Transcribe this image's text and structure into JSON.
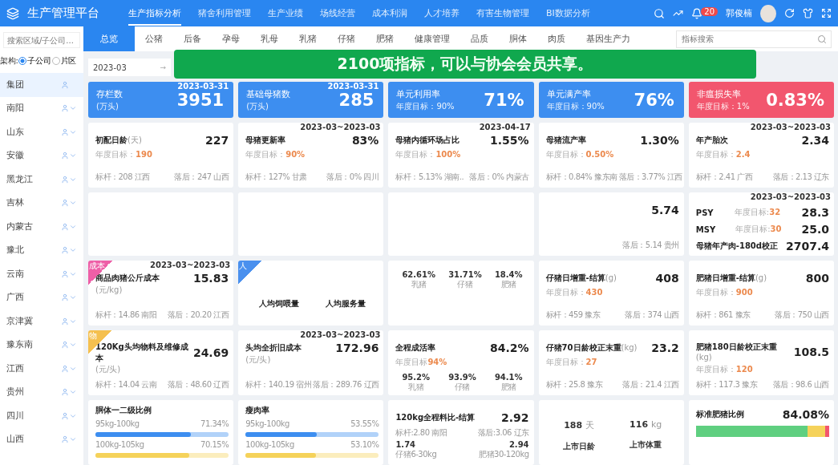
{
  "app": {
    "title": "生产管理平台"
  },
  "nav": [
    {
      "label": "生产指标分析",
      "selected": true
    },
    {
      "label": "猪舍利用管理",
      "selected": false
    },
    {
      "label": "生产业绩",
      "selected": false
    },
    {
      "label": "场线经营",
      "selected": false
    },
    {
      "label": "成本利润",
      "selected": false
    },
    {
      "label": "人才培养",
      "selected": false
    },
    {
      "label": "有害生物管理",
      "selected": false
    },
    {
      "label": "BI数据分析",
      "selected": false
    }
  ],
  "user": {
    "name": "郭俊楠",
    "notifications": "20"
  },
  "sidebar": {
    "search_placeholder": "搜索区域/子公司...",
    "structure_label": "架构:",
    "structure_options": [
      {
        "label": "子公司",
        "selected": true
      },
      {
        "label": "片区",
        "selected": false
      }
    ],
    "items": [
      {
        "label": "集团",
        "selected": true,
        "expandable": false
      },
      {
        "label": "南阳",
        "selected": false,
        "expandable": true
      },
      {
        "label": "山东",
        "selected": false,
        "expandable": true
      },
      {
        "label": "安徽",
        "selected": false,
        "expandable": true
      },
      {
        "label": "黑龙江",
        "selected": false,
        "expandable": true
      },
      {
        "label": "吉林",
        "selected": false,
        "expandable": true
      },
      {
        "label": "内蒙古",
        "selected": false,
        "expandable": true
      },
      {
        "label": "豫北",
        "selected": false,
        "expandable": true
      },
      {
        "label": "云南",
        "selected": false,
        "expandable": true
      },
      {
        "label": "广西",
        "selected": false,
        "expandable": true
      },
      {
        "label": "京津冀",
        "selected": false,
        "expandable": true
      },
      {
        "label": "豫东南",
        "selected": false,
        "expandable": true
      },
      {
        "label": "江西",
        "selected": false,
        "expandable": true
      },
      {
        "label": "贵州",
        "selected": false,
        "expandable": true
      },
      {
        "label": "四川",
        "selected": false,
        "expandable": true
      },
      {
        "label": "山西",
        "selected": false,
        "expandable": true
      }
    ]
  },
  "tabs": [
    {
      "label": "总览",
      "selected": true
    },
    {
      "label": "公猪",
      "selected": false
    },
    {
      "label": "后备",
      "selected": false
    },
    {
      "label": "孕母",
      "selected": false
    },
    {
      "label": "乳母",
      "selected": false
    },
    {
      "label": "乳猪",
      "selected": false
    },
    {
      "label": "仔猪",
      "selected": false
    },
    {
      "label": "肥猪",
      "selected": false
    },
    {
      "label": "健康管理",
      "selected": false
    },
    {
      "label": "品质",
      "selected": false
    },
    {
      "label": "胴体",
      "selected": false
    },
    {
      "label": "肉质",
      "selected": false
    },
    {
      "label": "基因生产力",
      "selected": false
    }
  ],
  "indicator_search": {
    "placeholder": "指标搜索"
  },
  "date_field": {
    "value": "2023-03",
    "arrow": "→"
  },
  "banner": {
    "text": "2100项指标，可以与协会会员共享。"
  },
  "kpis": [
    {
      "title": "存栏数",
      "sub": "(万头)",
      "value": "3951",
      "date": "2023-03-31",
      "color": "#3d8ef0"
    },
    {
      "title": "基础母猪数",
      "sub": "(万头)",
      "value": "285",
      "date": "2023-03-31",
      "color": "#3d8ef0"
    },
    {
      "title": "单元利用率",
      "sub": "年度目标：90%",
      "value": "71%",
      "color": "#3d8ef0"
    },
    {
      "title": "单元满产率",
      "sub": "年度目标：90%",
      "value": "76%",
      "color": "#3d8ef0"
    },
    {
      "title": "非瘟损失率",
      "sub": "年度目标：1%",
      "value": "0.83%",
      "color": "#f2566e"
    }
  ],
  "cards": [
    {
      "kind": "metric",
      "title": "初配日龄",
      "unit": "(天)",
      "value": "227",
      "target_label": "年度目标：",
      "target": "190",
      "bench": "标杆：208 江西",
      "lag": "落后：247 山西"
    },
    {
      "kind": "metric",
      "date": "2023-03~2023-03",
      "title": "母猪更新率",
      "value": "83%",
      "target_label": "年度目标：",
      "target": "90%",
      "bench": "标杆：127% 甘肃",
      "lag": "落后：0% 四川"
    },
    {
      "kind": "metric",
      "date": "2023-04-17",
      "title": "母猪内循环场占比",
      "value": "1.55%",
      "target_label": "年度目标：",
      "target": "100%",
      "bench": "标杆：5.13% 湖南..",
      "lag": "落后：0% 内蒙古"
    },
    {
      "kind": "metric",
      "title": "母猪流产率",
      "value": "1.30%",
      "target_label": "年度目标：",
      "target": "0.50%",
      "bench": "标杆：0.84% 豫东南",
      "lag": "落后：3.77% 江西"
    },
    {
      "kind": "metric",
      "date": "2023-03~2023-03",
      "title": "年产胎次",
      "value": "2.34",
      "target_label": "年度目标：",
      "target": "2.4",
      "bench": "标杆：2.41 广西",
      "lag": "落后：2.13 辽东"
    },
    {
      "kind": "metric"
    },
    {
      "kind": "metric"
    },
    {
      "kind": "metric"
    },
    {
      "kind": "metric",
      "value": "5.74",
      "lag": "落后：5.14 贵州"
    },
    {
      "kind": "rows",
      "date": "2023-03~2023-03",
      "rows": [
        {
          "name": "PSY",
          "target_label": "年度目标:",
          "target": "32",
          "value": "28.3"
        },
        {
          "name": "MSY",
          "target_label": "年度目标:",
          "target": "30",
          "value": "25.0"
        },
        {
          "name": "母猪年产肉-180d校正",
          "value": "2707.4"
        }
      ]
    },
    {
      "kind": "metric",
      "badge": {
        "label": "成本",
        "color": "#ee5fa7"
      },
      "date": "2023-03~2023-03",
      "title": "商品肉猪公斤成本",
      "value": "15.83",
      "sub": "(元/kg)",
      "bench": "标杆：14.86 南阳",
      "lag": "落后：20.20 江西"
    },
    {
      "kind": "people",
      "badge": {
        "label": "人",
        "color": "#4a90ee"
      },
      "labels": [
        "人均饲喂量",
        "人均服务量"
      ]
    },
    {
      "kind": "metric",
      "stats": [
        {
          "value": "62.61%",
          "label": "乳猪"
        },
        {
          "value": "31.71%",
          "label": "仔猪"
        },
        {
          "value": "18.4%",
          "label": "肥猪"
        }
      ]
    },
    {
      "kind": "metric",
      "title": "仔猪日增重-结算",
      "unit": "(g)",
      "value": "408",
      "target_label": "年度目标：",
      "target": "430",
      "bench": "标杆：459 豫东",
      "lag": "落后：374 山西"
    },
    {
      "kind": "metric",
      "title": "肥猪日增重-结算",
      "unit": "(g)",
      "value": "800",
      "target_label": "年度目标：",
      "target": "900",
      "bench": "标杆：861 豫东",
      "lag": "落后：750 山西"
    },
    {
      "kind": "metric",
      "badge": {
        "label": "物",
        "color": "#f5c04f"
      },
      "title": "120Kg头均物料及维修成本",
      "value": "24.69",
      "sub": "(元/头)",
      "bench": "标杆：14.04 云南",
      "lag": "落后：48.60 辽西"
    },
    {
      "kind": "metric",
      "date": "2023-03~2023-03",
      "title": "头均全折旧成本",
      "value": "172.96",
      "sub": "(元/头)",
      "bench": "标杆：140.19 宿州",
      "lag": "落后：289.76 辽西"
    },
    {
      "kind": "metric",
      "title": "全程成活率",
      "value": "84.2%",
      "target_label": "年度目标",
      "target": "94%",
      "stats": [
        {
          "value": "95.2%",
          "label": "乳猪"
        },
        {
          "value": "93.9%",
          "label": "仔猪"
        },
        {
          "value": "94.1%",
          "label": "肥猪"
        }
      ]
    },
    {
      "kind": "metric",
      "title": "仔猪70日龄校正末重",
      "unit": "(kg)",
      "value": "23.2",
      "target_label": "年度目标：",
      "target": "27",
      "bench": "标杆：25.8 豫东",
      "lag": "落后：21.4 江西"
    },
    {
      "kind": "metric",
      "title": "肥猪180日龄校正末重",
      "unit": "(kg)",
      "value": "108.5",
      "target_label": "年度目标：",
      "target": "120",
      "bench": "标杆：117.3 豫东",
      "lag": "落后：98.6 山西"
    },
    {
      "kind": "bars",
      "title": "胴体一二级比例",
      "bars": [
        {
          "label": "95kg-100kg",
          "reading": "71.34%",
          "level": 0.7134,
          "color": "#3d8ef0"
        },
        {
          "label": "100kg-105kg",
          "reading": "70.15%",
          "level": 0.7015,
          "color": "#f5d25a"
        }
      ]
    },
    {
      "kind": "bars",
      "title": "瘦肉率",
      "bars": [
        {
          "label": "95kg-100kg",
          "reading": "53.55%",
          "level": 0.5355,
          "color": "#3d8ef0"
        },
        {
          "label": "100kg-105kg",
          "reading": "53.10%",
          "level": 0.531,
          "color": "#f5d25a"
        }
      ]
    },
    {
      "kind": "split",
      "title": "120kg全程料比-结算",
      "value": "2.92",
      "bench": "标杆:2.80 南阳",
      "lag": "落后:3.06 辽东",
      "stats": [
        {
          "value": "1.74",
          "label": "仔猪6-30kg"
        },
        {
          "value": "2.94",
          "label": "肥猪30-120kg"
        }
      ]
    },
    {
      "kind": "pair",
      "items": [
        {
          "value": "188",
          "unit": "天",
          "label": "上市日龄"
        },
        {
          "value": "116",
          "unit": "kg",
          "label": "上市体重"
        }
      ]
    },
    {
      "kind": "stack",
      "title": "标准肥猪比例",
      "value": "84.08%",
      "level": 0.84
    }
  ]
}
